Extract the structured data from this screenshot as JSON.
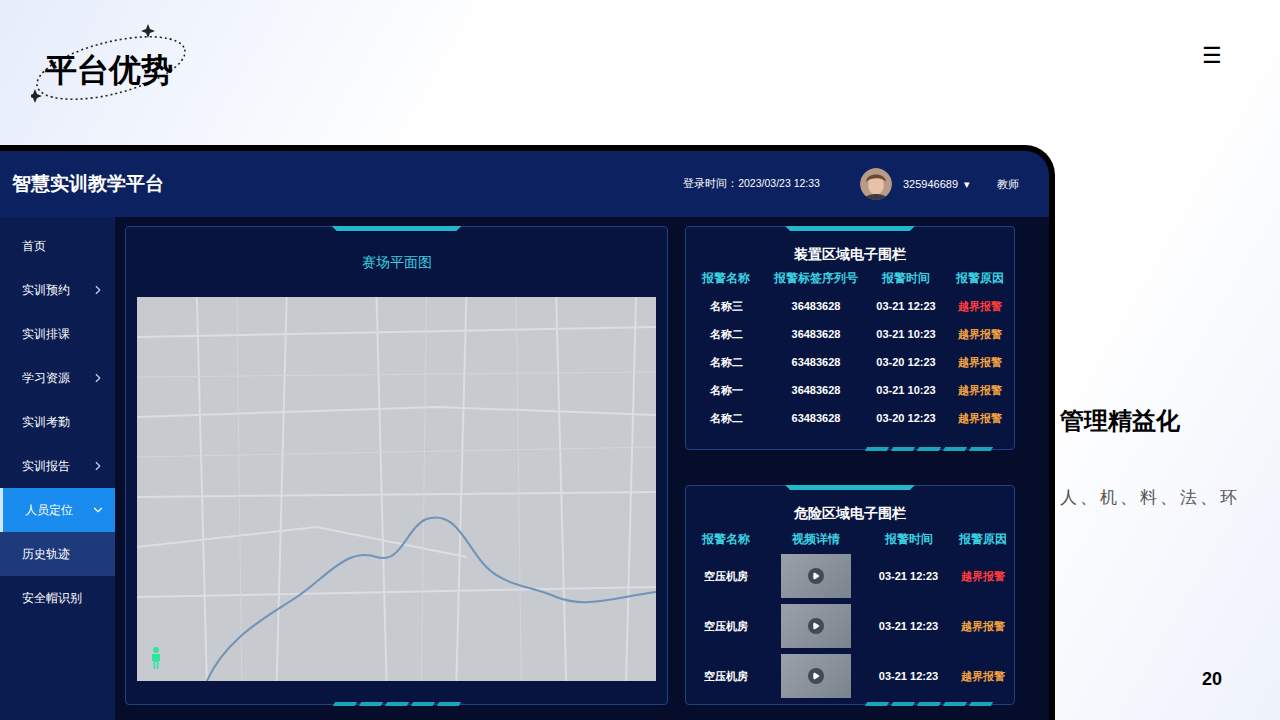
{
  "slide": {
    "title": "平台优势",
    "menu_icon": "☰",
    "page_number": "20",
    "feature": {
      "heading": "管理精益化",
      "text": "人、机、料、法、环"
    }
  },
  "app": {
    "title": "智慧实训教学平台",
    "login_time": "登录时间：2023/03/23 12:33",
    "user": {
      "id": "325946689",
      "dropdown": "▾",
      "role": "教师"
    }
  },
  "sidebar": {
    "items": [
      {
        "label": "首页",
        "expandable": false,
        "expanded": false,
        "selected": false,
        "highlighted": false
      },
      {
        "label": "实训预约",
        "expandable": true,
        "expanded": false,
        "selected": false,
        "highlighted": false
      },
      {
        "label": "实训排课",
        "expandable": false,
        "expanded": false,
        "selected": false,
        "highlighted": false
      },
      {
        "label": "学习资源",
        "expandable": true,
        "expanded": false,
        "selected": false,
        "highlighted": false
      },
      {
        "label": "实训考勤",
        "expandable": false,
        "expanded": false,
        "selected": false,
        "highlighted": false
      },
      {
        "label": "实训报告",
        "expandable": true,
        "expanded": false,
        "selected": false,
        "highlighted": false
      },
      {
        "label": "人员定位",
        "expandable": true,
        "expanded": true,
        "selected": true,
        "highlighted": false
      },
      {
        "label": "历史轨迹",
        "expandable": false,
        "expanded": false,
        "selected": false,
        "highlighted": true
      },
      {
        "label": "安全帽识别",
        "expandable": false,
        "expanded": false,
        "selected": false,
        "highlighted": false
      }
    ]
  },
  "map_panel": {
    "title": "赛场平面图"
  },
  "device_fence": {
    "title": "装置区域电子围栏",
    "columns": [
      "报警名称",
      "报警标签序列号",
      "报警时间",
      "报警原因"
    ],
    "rows": [
      {
        "name": "名称三",
        "serial": "36483628",
        "time": "03-21 12:23",
        "reason": "越界报警",
        "color": "#ff3b3b"
      },
      {
        "name": "名称二",
        "serial": "36483628",
        "time": "03-21 10:23",
        "reason": "越界报警",
        "color": "#f0a040"
      },
      {
        "name": "名称二",
        "serial": "63483628",
        "time": "03-20 12:23",
        "reason": "越界报警",
        "color": "#f0a040"
      },
      {
        "name": "名称一",
        "serial": "36483628",
        "time": "03-21 10:23",
        "reason": "越界报警",
        "color": "#f0a040"
      },
      {
        "name": "名称二",
        "serial": "63483628",
        "time": "03-20 12:23",
        "reason": "越界报警",
        "color": "#f0a040"
      }
    ]
  },
  "danger_fence": {
    "title": "危险区域电子围栏",
    "columns": [
      "报警名称",
      "视频详情",
      "报警时间",
      "报警原因"
    ],
    "rows": [
      {
        "name": "空压机房",
        "time": "03-21 12:23",
        "reason": "越界报警",
        "color": "#ff3b3b"
      },
      {
        "name": "空压机房",
        "time": "03-21 12:23",
        "reason": "越界报警",
        "color": "#f0a040"
      },
      {
        "name": "空压机房",
        "time": "03-21 12:23",
        "reason": "越界报警",
        "color": "#f0a040"
      }
    ]
  }
}
